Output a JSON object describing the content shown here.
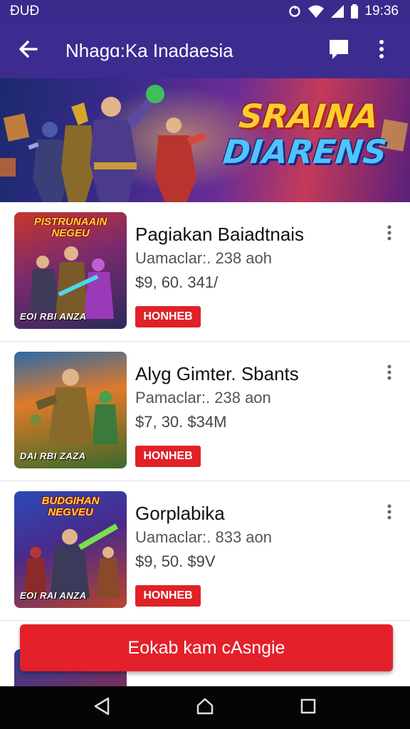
{
  "status_bar": {
    "carrier": "ĐUĐ",
    "time": "19:36"
  },
  "app_bar": {
    "title": "Nhagɑ:Ka Inadaesia",
    "back_icon": "arrow-left-icon",
    "chat_icon": "chat-bubble-icon",
    "more_icon": "more-vertical-icon"
  },
  "banner": {
    "title_line1": "SRAINA",
    "title_line2": "DIARENS"
  },
  "items": [
    {
      "thumb_label": "PISTRUNAAIN NEGEU",
      "thumb_caption": "EOI RBI ANZA",
      "title": "Pagiakan Baiadtnais",
      "subtitle": "Uamaclar:. 238  aoh",
      "price": "$9, 60. 341/",
      "badge": "HONHEB"
    },
    {
      "thumb_label": "",
      "thumb_caption": "DAI RBI ZAZA",
      "title": "Alуg Gimter. Sbants",
      "subtitle": "Pamaclar:. 238  aon",
      "price": "$7, 30. $34M",
      "badge": "HONHEB"
    },
    {
      "thumb_label": "BUDGIHAN NEGVEU",
      "thumb_caption": "EOI RAI ANZA",
      "title": "Gorplabika",
      "subtitle": "Uamaclar:. 833  aon",
      "price": "$9, 50. $9V",
      "badge": "HONHEB"
    }
  ],
  "cta": {
    "label": "Eokab kam cAsngie"
  },
  "colors": {
    "appbar": "#3e2b90",
    "accent_red": "#e4202a",
    "navbar": "#050505"
  }
}
